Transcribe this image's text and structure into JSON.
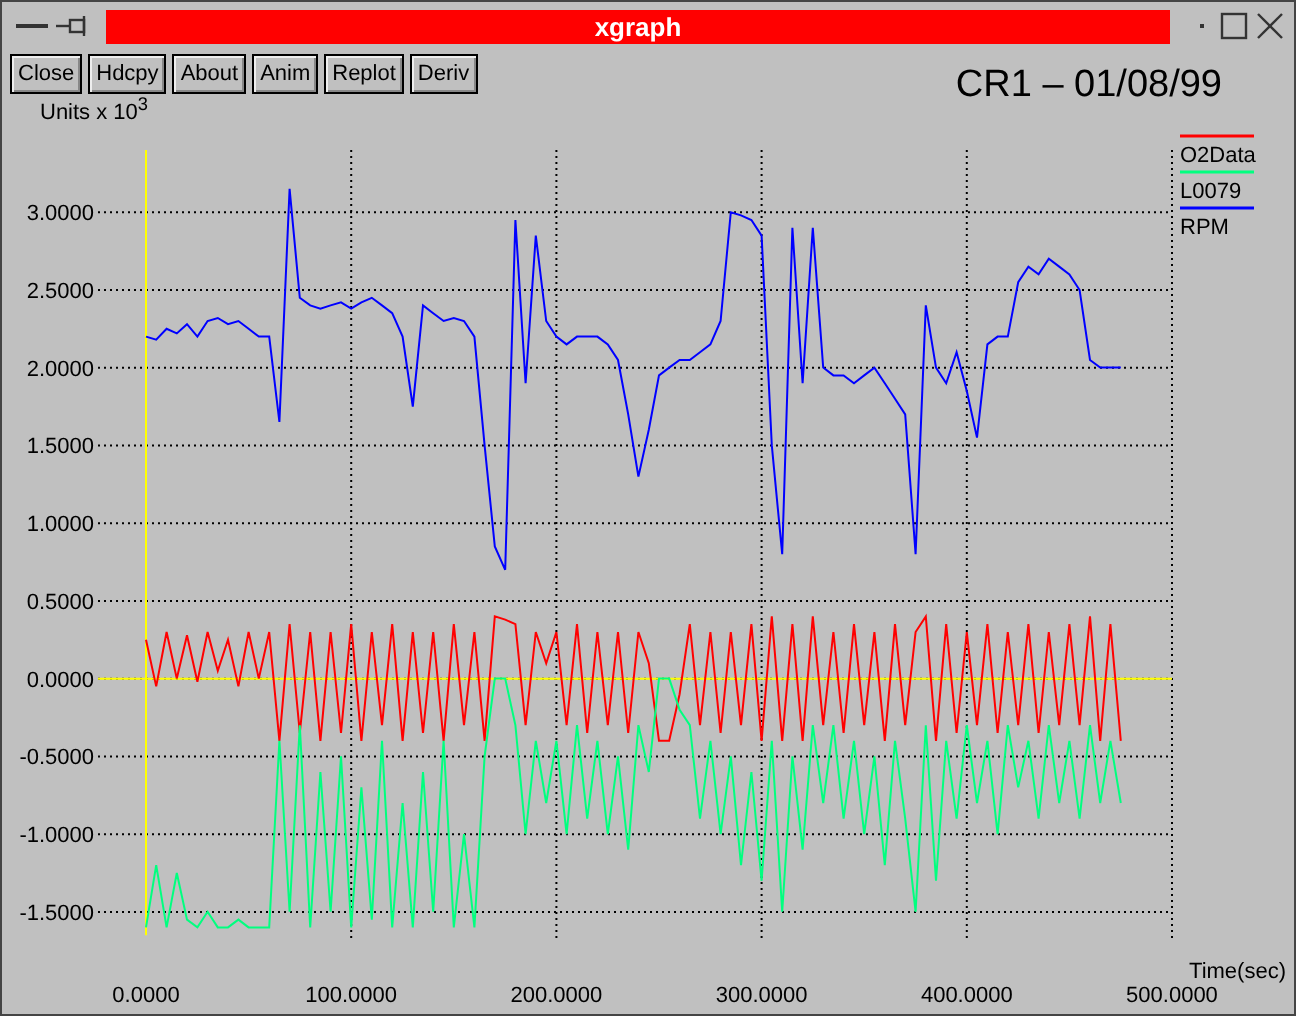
{
  "window": {
    "title": "xgraph"
  },
  "buttons": [
    "Close",
    "Hdcpy",
    "About",
    "Anim",
    "Replot",
    "Deriv"
  ],
  "plot": {
    "title": "CR1 – 01/08/99",
    "chart_data": {
      "type": "line",
      "ylabel": "Units x 10$^{3}$",
      "xlabel": "Time(sec)",
      "xlim": [
        0,
        500
      ],
      "ylim": [
        -1.65,
        3.4
      ],
      "grid": true,
      "legend": true,
      "ref_lines": [
        {
          "axis": "y",
          "value": 0,
          "color": "#ffff00"
        }
      ],
      "xticks": [
        {
          "value": 0,
          "label": "0.0000"
        },
        {
          "value": 100,
          "label": "100.0000"
        },
        {
          "value": 200,
          "label": "200.0000"
        },
        {
          "value": 300,
          "label": "300.0000"
        },
        {
          "value": 400,
          "label": "400.0000"
        },
        {
          "value": 500,
          "label": "500.0000"
        }
      ],
      "yticks": [
        {
          "value": 3,
          "label": "3.0000"
        },
        {
          "value": 2.5,
          "label": "2.5000"
        },
        {
          "value": 2,
          "label": "2.0000"
        },
        {
          "value": 1.5,
          "label": "1.5000"
        },
        {
          "value": 1,
          "label": "1.0000"
        },
        {
          "value": 0.5,
          "label": "0.5000"
        },
        {
          "value": 0,
          "label": "0.0000"
        },
        {
          "value": -0.5,
          "label": "-0.5000"
        },
        {
          "value": -1,
          "label": "-1.0000"
        },
        {
          "value": -1.5,
          "label": "-1.5000"
        }
      ],
      "x": [
        0,
        5,
        10,
        15,
        20,
        25,
        30,
        35,
        40,
        45,
        50,
        55,
        60,
        65,
        70,
        75,
        80,
        85,
        90,
        95,
        100,
        105,
        110,
        115,
        120,
        125,
        130,
        135,
        140,
        145,
        150,
        155,
        160,
        165,
        170,
        175,
        180,
        185,
        190,
        195,
        200,
        205,
        210,
        215,
        220,
        225,
        230,
        235,
        240,
        245,
        250,
        255,
        260,
        265,
        270,
        275,
        280,
        285,
        290,
        295,
        300,
        305,
        310,
        315,
        320,
        325,
        330,
        335,
        340,
        345,
        350,
        355,
        360,
        365,
        370,
        375,
        380,
        385,
        390,
        395,
        400,
        405,
        410,
        415,
        420,
        425,
        430,
        435,
        440,
        445,
        450,
        455,
        460,
        465,
        470,
        475
      ],
      "series": [
        {
          "name": "O2Data",
          "color": "#ff0000",
          "values": [
            0.25,
            -0.05,
            0.3,
            0.0,
            0.28,
            -0.02,
            0.3,
            0.05,
            0.25,
            -0.05,
            0.3,
            0.0,
            0.3,
            -0.4,
            0.35,
            -0.35,
            0.3,
            -0.4,
            0.3,
            -0.35,
            0.35,
            -0.4,
            0.3,
            -0.3,
            0.35,
            -0.4,
            0.3,
            -0.35,
            0.3,
            -0.4,
            0.35,
            -0.3,
            0.3,
            -0.4,
            0.4,
            0.38,
            0.35,
            -0.3,
            0.3,
            0.1,
            0.3,
            -0.3,
            0.35,
            -0.35,
            0.3,
            -0.3,
            0.3,
            -0.35,
            0.3,
            0.1,
            -0.4,
            -0.4,
            -0.1,
            0.35,
            -0.3,
            0.3,
            -0.35,
            0.3,
            -0.3,
            0.35,
            -0.4,
            0.4,
            -0.4,
            0.35,
            -0.4,
            0.4,
            -0.3,
            0.3,
            -0.35,
            0.35,
            -0.3,
            0.3,
            -0.4,
            0.35,
            -0.3,
            0.3,
            0.4,
            -0.4,
            0.35,
            -0.35,
            0.3,
            -0.3,
            0.35,
            -0.35,
            0.3,
            -0.3,
            0.35,
            -0.35,
            0.3,
            -0.3,
            0.35,
            -0.3,
            0.4,
            -0.4,
            0.35,
            -0.4
          ]
        },
        {
          "name": "L0079",
          "color": "#00ff7f",
          "values": [
            -1.6,
            -1.2,
            -1.6,
            -1.25,
            -1.55,
            -1.6,
            -1.5,
            -1.6,
            -1.6,
            -1.55,
            -1.6,
            -1.6,
            -1.6,
            -0.4,
            -1.5,
            -0.3,
            -1.6,
            -0.6,
            -1.5,
            -0.5,
            -1.6,
            -0.7,
            -1.55,
            -0.4,
            -1.6,
            -0.8,
            -1.6,
            -0.6,
            -1.5,
            -0.4,
            -1.6,
            -1.0,
            -1.6,
            -0.5,
            0.0,
            0.0,
            -0.3,
            -1.0,
            -0.4,
            -0.8,
            -0.4,
            -1.0,
            -0.3,
            -0.9,
            -0.4,
            -1.0,
            -0.5,
            -1.1,
            -0.3,
            -0.6,
            0.0,
            0.0,
            -0.2,
            -0.3,
            -0.9,
            -0.4,
            -1.0,
            -0.5,
            -1.2,
            -0.6,
            -1.3,
            -0.4,
            -1.5,
            -0.5,
            -1.1,
            -0.3,
            -0.8,
            -0.3,
            -0.9,
            -0.4,
            -1.0,
            -0.5,
            -1.2,
            -0.4,
            -0.9,
            -1.5,
            -0.3,
            -1.3,
            -0.4,
            -0.9,
            -0.3,
            -0.8,
            -0.4,
            -1.0,
            -0.3,
            -0.7,
            -0.4,
            -0.9,
            -0.3,
            -0.8,
            -0.4,
            -0.9,
            -0.3,
            -0.8,
            -0.4,
            -0.8
          ]
        },
        {
          "name": "RPM",
          "color": "#0000ff",
          "values": [
            2.2,
            2.18,
            2.25,
            2.22,
            2.28,
            2.2,
            2.3,
            2.32,
            2.28,
            2.3,
            2.25,
            2.2,
            2.2,
            1.65,
            3.15,
            2.45,
            2.4,
            2.38,
            2.4,
            2.42,
            2.38,
            2.42,
            2.45,
            2.4,
            2.35,
            2.2,
            1.75,
            2.4,
            2.35,
            2.3,
            2.32,
            2.3,
            2.2,
            1.5,
            0.85,
            0.7,
            2.95,
            1.9,
            2.85,
            2.3,
            2.2,
            2.15,
            2.2,
            2.2,
            2.2,
            2.15,
            2.05,
            1.7,
            1.3,
            1.6,
            1.95,
            2.0,
            2.05,
            2.05,
            2.1,
            2.15,
            2.3,
            3.0,
            2.98,
            2.95,
            2.85,
            1.5,
            0.8,
            2.9,
            1.9,
            2.9,
            2.0,
            1.95,
            1.95,
            1.9,
            1.95,
            2.0,
            1.9,
            1.8,
            1.7,
            0.8,
            2.4,
            2.0,
            1.9,
            2.1,
            1.85,
            1.55,
            2.15,
            2.2,
            2.2,
            2.55,
            2.65,
            2.6,
            2.7,
            2.65,
            2.6,
            2.5,
            2.05,
            2.0,
            2.0,
            2.0
          ]
        }
      ]
    }
  }
}
